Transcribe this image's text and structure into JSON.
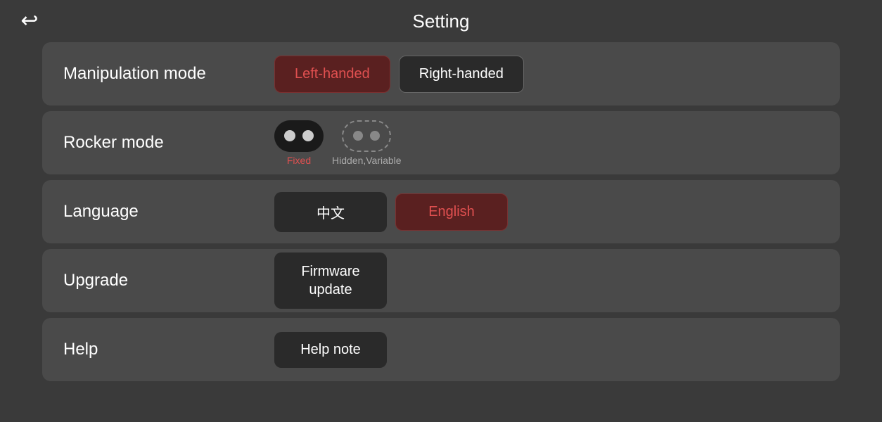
{
  "header": {
    "title": "Setting",
    "back_label": "↩"
  },
  "rows": [
    {
      "id": "manipulation-mode",
      "label": "Manipulation mode",
      "controls": [
        {
          "id": "left-handed",
          "text": "Left-handed",
          "active": true
        },
        {
          "id": "right-handed",
          "text": "Right-handed",
          "active": false
        }
      ]
    },
    {
      "id": "rocker-mode",
      "label": "Rocker mode",
      "fixed_label": "Fixed",
      "hidden_label": "Hidden,Variable"
    },
    {
      "id": "language",
      "label": "Language",
      "controls": [
        {
          "id": "chinese",
          "text": "中文",
          "active": false
        },
        {
          "id": "english",
          "text": "English",
          "active": true
        }
      ]
    },
    {
      "id": "upgrade",
      "label": "Upgrade",
      "button_text": "Firmware\nupdate"
    },
    {
      "id": "help",
      "label": "Help",
      "button_text": "Help note"
    }
  ]
}
